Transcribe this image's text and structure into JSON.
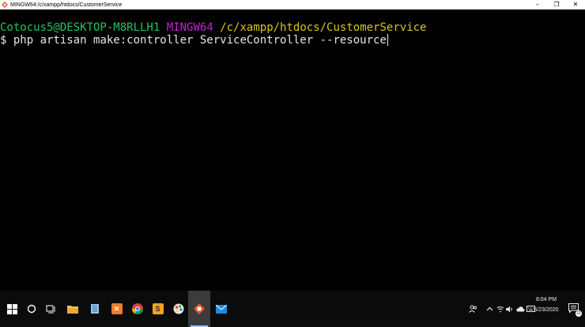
{
  "window": {
    "title": "MINGW64:/c/xampp/htdocs/CustomerService",
    "controls": {
      "minimize": "–",
      "restore": "❐",
      "close": "✕"
    }
  },
  "terminal": {
    "user_host": "Cotocus5@DESKTOP-M8RLLH1",
    "system": "MINGW64",
    "cwd": "/c/xampp/htdocs/CustomerService",
    "prompt_symbol": "$",
    "command": "php artisan make:controller ServiceController --resource",
    "colors": {
      "user_host": "#22c55e",
      "system": "#c026d3",
      "cwd": "#d9c51a",
      "text": "#e6e6e6",
      "background": "#000000"
    }
  },
  "taskbar": {
    "apps": [
      {
        "icon": "file-explorer-icon"
      },
      {
        "icon": "notepad-icon"
      },
      {
        "icon": "xampp-icon"
      },
      {
        "icon": "chrome-icon"
      },
      {
        "icon": "sublime-text-icon"
      },
      {
        "icon": "paint-icon"
      },
      {
        "icon": "git-bash-icon",
        "active": true
      },
      {
        "icon": "mail-icon"
      }
    ],
    "clock": {
      "time": "8:04 PM",
      "date": "6/23/2020"
    },
    "notification_count": "21"
  }
}
